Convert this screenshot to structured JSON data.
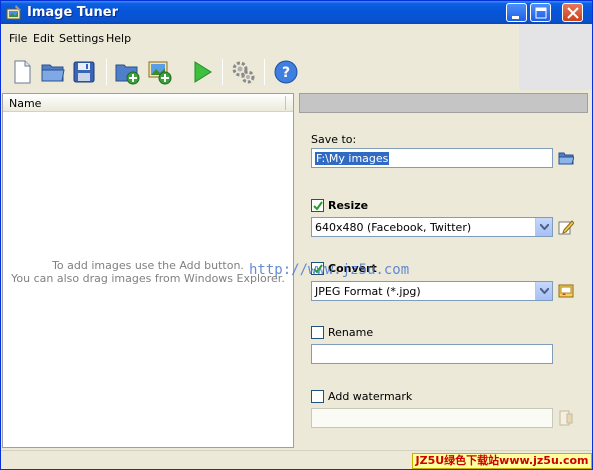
{
  "window": {
    "title": "Image Tuner"
  },
  "menu": [
    "File",
    "Edit",
    "Settings",
    "Help"
  ],
  "toolbar": {
    "icons": [
      "new-file-icon",
      "open-folder-icon",
      "save-icon",
      "add-folder-icon",
      "add-image-icon",
      "run-icon",
      "settings-icon",
      "help-icon"
    ],
    "help_glyph": "?"
  },
  "list": {
    "column_name": "Name",
    "empty_line1": "To add images use the Add button.",
    "empty_line2": "You can also drag images from Windows Explorer."
  },
  "panel": {
    "save_to_label": "Save to:",
    "save_to_value": "F:\\My images",
    "resize_label": "Resize",
    "resize_checked": true,
    "resize_value": "640x480 (Facebook, Twitter)",
    "convert_label": "Convert",
    "convert_checked": true,
    "convert_value": "JPEG Format (*.jpg)",
    "rename_label": "Rename",
    "rename_checked": false,
    "rename_value": "",
    "watermark_label": "Add watermark",
    "watermark_checked": false,
    "watermark_value": ""
  },
  "overlay": {
    "url": "http://www.jz5u.com",
    "badge": "JZ5U绿色下载站www.jz5u.com"
  },
  "colors": {
    "titlebar": "#0654d8",
    "selection": "#316ac5",
    "window_bg": "#ece9d8"
  }
}
